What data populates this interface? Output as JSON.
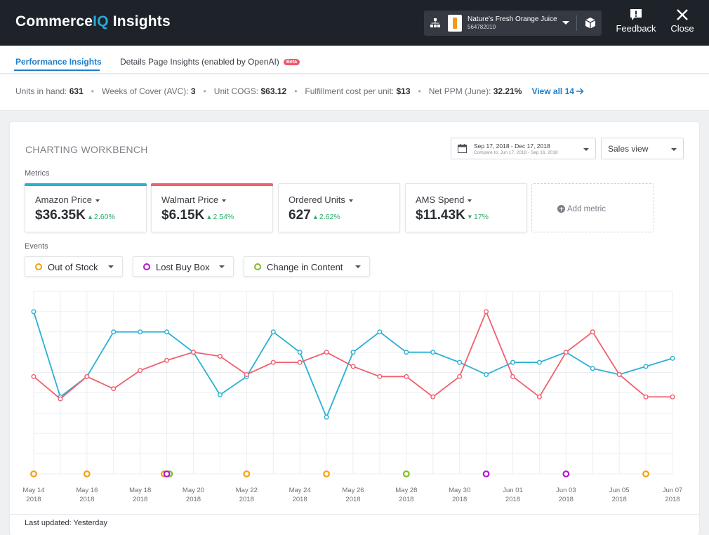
{
  "app": {
    "brand_prefix": "Commerce",
    "brand_iq": "IQ",
    "brand_suffix": " Insights"
  },
  "product": {
    "name": "Nature's Fresh Orange Juice",
    "id": "564782010"
  },
  "header_actions": {
    "feedback_label": "Feedback",
    "close_label": "Close"
  },
  "tabs": {
    "performance": "Performance Insights",
    "details": "Details Page Insights (enabled by OpenAI)",
    "beta": "Beta"
  },
  "summary": {
    "units_label": "Units in hand:",
    "units_value": "631",
    "woc_label": "Weeks of Cover (AVC):",
    "woc_value": "3",
    "cogs_label": "Unit COGS:",
    "cogs_value": "$63.12",
    "fulfill_label": "Fulfillment cost per unit:",
    "fulfill_value": "$13",
    "ppm_label": "Net PPM (June):",
    "ppm_value": "32.21%",
    "view_all": "View all 14"
  },
  "workbench": {
    "title": "CHARTING WORKBENCH",
    "date_range": "Sep 17, 2018 - Dec 17, 2018",
    "compare_to": "Compare to: Jun 17, 2018 - Sep 16, 2018",
    "view": "Sales view",
    "metrics_label": "Metrics",
    "events_label": "Events",
    "add_metric": "Add metric",
    "last_updated": "Last updated: Yesterday"
  },
  "metrics": [
    {
      "name": "Amazon Price",
      "value": "$36.35K",
      "delta": "2.60%",
      "direction": "up",
      "color": "#29b0d4"
    },
    {
      "name": "Walmart Price",
      "value": "$6.15K",
      "delta": "2.54%",
      "direction": "up",
      "color": "#f0606e"
    },
    {
      "name": "Ordered Units",
      "value": "627",
      "delta": "2.62%",
      "direction": "up",
      "color": ""
    },
    {
      "name": "AMS Spend",
      "value": "$11.43K",
      "delta": "17%",
      "direction": "down",
      "color": ""
    }
  ],
  "events": [
    {
      "name": "Out of Stock",
      "color": "#f5a00f"
    },
    {
      "name": "Lost Buy Box",
      "color": "#b217cf"
    },
    {
      "name": "Change in Content",
      "color": "#7fbd1f"
    }
  ],
  "chart_data": {
    "type": "line",
    "x": [
      "May 14 2018",
      "May 15 2018",
      "May 16 2018",
      "May 17 2018",
      "May 18 2018",
      "May 19 2018",
      "May 20 2018",
      "May 21 2018",
      "May 22 2018",
      "May 23 2018",
      "May 24 2018",
      "May 25 2018",
      "May 26 2018",
      "May 27 2018",
      "May 28 2018",
      "May 29 2018",
      "May 30 2018",
      "May 31 2018",
      "Jun 01 2018",
      "Jun 02 2018",
      "Jun 03 2018",
      "Jun 04 2018",
      "Jun 05 2018",
      "Jun 06 2018",
      "Jun 07 2018"
    ],
    "tick_labels": [
      {
        "line1": "May 14",
        "line2": "2018"
      },
      {
        "line1": "May 16",
        "line2": "2018"
      },
      {
        "line1": "May 18",
        "line2": "2018"
      },
      {
        "line1": "May 20",
        "line2": "2018"
      },
      {
        "line1": "May 22",
        "line2": "2018"
      },
      {
        "line1": "May 24",
        "line2": "2018"
      },
      {
        "line1": "May 26",
        "line2": "2018"
      },
      {
        "line1": "May 28",
        "line2": "2018"
      },
      {
        "line1": "May 30",
        "line2": "2018"
      },
      {
        "line1": "Jun 01",
        "line2": "2018"
      },
      {
        "line1": "Jun 03",
        "line2": "2018"
      },
      {
        "line1": "Jun 05",
        "line2": "2018"
      },
      {
        "line1": "Jun 07",
        "line2": "2018"
      }
    ],
    "ylim": [
      0,
      9
    ],
    "grid": true,
    "series": [
      {
        "name": "Amazon Price",
        "color": "#29b0d4",
        "values": [
          8.0,
          3.8,
          4.8,
          7.0,
          7.0,
          7.0,
          6.0,
          3.9,
          4.8,
          7.0,
          6.0,
          2.8,
          6.0,
          7.0,
          6.0,
          6.0,
          5.5,
          4.9,
          5.5,
          5.5,
          6.0,
          5.2,
          4.9,
          5.3,
          5.7
        ]
      },
      {
        "name": "Walmart Price",
        "color": "#f0606e",
        "values": [
          4.8,
          3.7,
          4.8,
          4.2,
          5.1,
          5.6,
          6.0,
          5.8,
          4.9,
          5.5,
          5.5,
          6.0,
          5.3,
          4.8,
          4.8,
          3.8,
          4.8,
          8.0,
          4.8,
          3.8,
          6.0,
          7.0,
          4.9,
          3.8,
          3.8
        ]
      }
    ],
    "event_markers": [
      {
        "day": 0,
        "event": "Out of Stock"
      },
      {
        "day": 2,
        "event": "Out of Stock"
      },
      {
        "day": 4.9,
        "event": "Out of Stock"
      },
      {
        "day": 5.1,
        "event": "Change in Content"
      },
      {
        "day": 5.0,
        "event": "Lost Buy Box"
      },
      {
        "day": 8,
        "event": "Out of Stock"
      },
      {
        "day": 11,
        "event": "Out of Stock"
      },
      {
        "day": 14,
        "event": "Change in Content"
      },
      {
        "day": 17,
        "event": "Lost Buy Box"
      },
      {
        "day": 20,
        "event": "Lost Buy Box"
      },
      {
        "day": 23,
        "event": "Out of Stock"
      }
    ]
  }
}
